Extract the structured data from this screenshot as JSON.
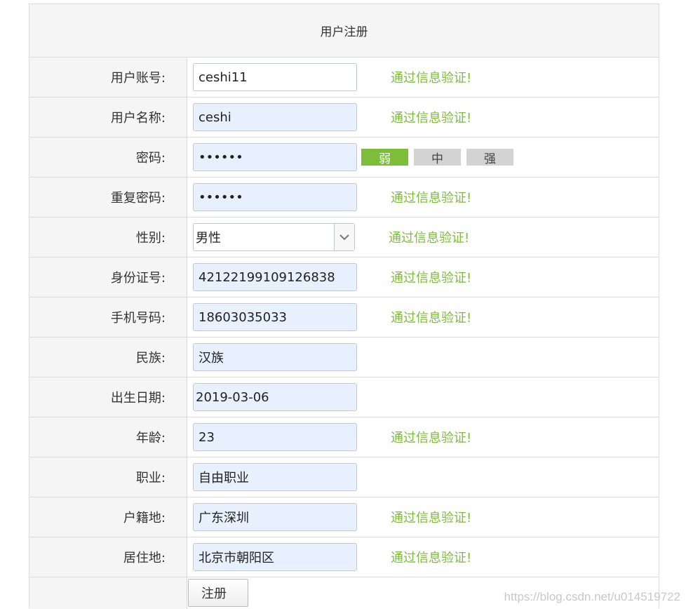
{
  "form": {
    "title": "用户注册",
    "submit_label": "注册",
    "valid_text": "通过信息验证!",
    "rows": [
      {
        "label": "用户账号:",
        "value": "ceshi11",
        "valid": "通过信息验证!"
      },
      {
        "label": "用户名称:",
        "value": "ceshi",
        "valid": "通过信息验证!"
      },
      {
        "label": "密码:",
        "value": "••••••"
      },
      {
        "label": "重复密码:",
        "value": "••••••",
        "valid": "通过信息验证!"
      },
      {
        "label": "性别:",
        "value": "男性",
        "valid": "通过信息验证!"
      },
      {
        "label": "身份证号:",
        "value": "42122199109126838",
        "valid": "通过信息验证!"
      },
      {
        "label": "手机号码:",
        "value": "18603035033",
        "valid": "通过信息验证!"
      },
      {
        "label": "民族:",
        "value": "汉族"
      },
      {
        "label": "出生日期:",
        "value": "2019-03-06"
      },
      {
        "label": "年龄:",
        "value": "23",
        "valid": "通过信息验证!"
      },
      {
        "label": "职业:",
        "value": "自由职业"
      },
      {
        "label": "户籍地:",
        "value": "广东深圳",
        "valid": "通过信息验证!"
      },
      {
        "label": "居住地:",
        "value": "北京市朝阳区",
        "valid": "通过信息验证!"
      }
    ]
  },
  "password_strength": {
    "weak": "弱",
    "medium": "中",
    "strong": "强",
    "active": "weak"
  },
  "colors": {
    "valid_green": "#7cbd3a",
    "label_bg": "#f5f5f5",
    "autofill_bg": "#e8f0fe"
  },
  "watermark": "https://blog.csdn.net/u014519722"
}
